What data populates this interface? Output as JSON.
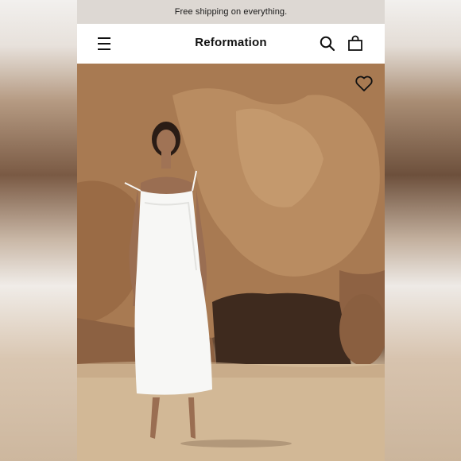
{
  "promo": {
    "text": "Free shipping on everything."
  },
  "header": {
    "brand": "Reformation"
  },
  "icons": {
    "menu": "hamburger-menu-icon",
    "search": "search-icon",
    "bag": "shopping-bag-icon",
    "favorite": "heart-icon"
  },
  "colors": {
    "promo_bg": "#ddd8d3",
    "text": "#111111",
    "rock": "#a6754d",
    "sand": "#d9c3a8",
    "dress": "#f7f7f5"
  }
}
